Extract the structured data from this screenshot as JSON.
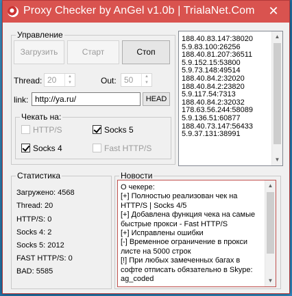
{
  "window": {
    "title": "Proxy Checker by AnGel v1.0b | TrialaNet.Com",
    "close_glyph": "✕"
  },
  "control": {
    "group_title": "Управление",
    "load_label": "Загрузить",
    "start_label": "Старт",
    "stop_label": "Стоп",
    "thread_label": "Thread:",
    "thread_value": "20",
    "out_label": "Out:",
    "out_value": "50",
    "link_label": "link:",
    "link_value": "http://ya.ru/",
    "head_label": "HEAD"
  },
  "check": {
    "group_title": "Чекать на:",
    "options": [
      {
        "label": "HTTP/S",
        "checked": false
      },
      {
        "label": "Socks 5",
        "checked": true
      },
      {
        "label": "Socks 4",
        "checked": true
      },
      {
        "label": "Fast HTTP/S",
        "checked": false
      }
    ]
  },
  "proxies": [
    "188.40.83.147:38020",
    "5.9.83.100:26256",
    "188.40.81.207:36511",
    "5.9.152.15:53800",
    "5.9.73.148:49514",
    "188.40.84.2:32020",
    "188.40.84.2:23820",
    "5.9.117.54:7313",
    "188.40.84.2:32032",
    "178.63.56.244:58089",
    "5.9.136.51:60877",
    "188.40.73.147:56433",
    "5.9.37.131:38991"
  ],
  "stats": {
    "group_title": "Статистика",
    "items": [
      "Загружено: 4568",
      "Thread: 20",
      "HTTP/S: 0",
      "Socks 4: 2",
      "Socks 5: 2012",
      "FAST HTTP/S: 0",
      "BAD: 5585"
    ]
  },
  "news": {
    "group_title": "Новости",
    "lines": [
      "О чекере:",
      "[+] Полностью реализован чек на HTTP/S | Socks 4/5",
      "[+] Добавлена функция чека на самые быстрые прокси - Fast HTTP/S",
      "[+] Исправлены ошибки",
      "[-] Временное ограничение в прокси листе на 5000 строк",
      "[!] При любых замеченных багах в софте отписать обязательно в Skype: ag_coded"
    ]
  }
}
